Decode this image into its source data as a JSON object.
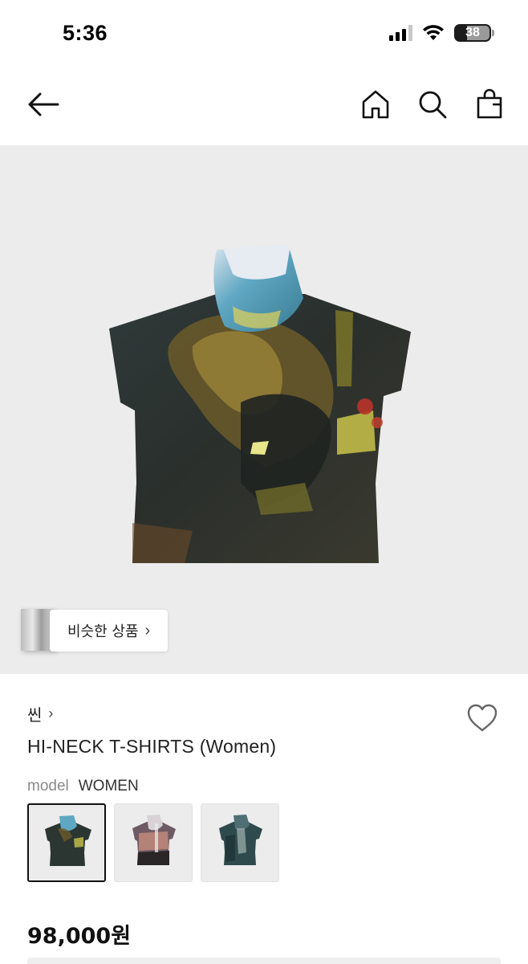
{
  "status_bar": {
    "time": "5:36",
    "battery_percent": "38",
    "icons": [
      "signal-icon",
      "wifi-icon",
      "battery-icon"
    ]
  },
  "nav": {
    "icons": [
      "back-arrow-icon",
      "home-icon",
      "search-icon",
      "shopping-bag-icon"
    ]
  },
  "hero": {
    "background": "#ececec",
    "similar_items_label": "비슷한 상품",
    "chevron": "›"
  },
  "product": {
    "brand": "씬",
    "brand_chevron": "›",
    "name": "HI-NECK T-SHIRTS (Women)",
    "model_label": "model",
    "model_value": "WOMEN",
    "price": "98,000원",
    "variants": [
      {
        "name": "variant-1",
        "selected": true
      },
      {
        "name": "variant-2",
        "selected": false
      },
      {
        "name": "variant-3",
        "selected": false
      }
    ]
  },
  "colors": {
    "text_primary": "#111111",
    "text_muted": "#8a8a8a",
    "image_bg": "#ececec"
  }
}
